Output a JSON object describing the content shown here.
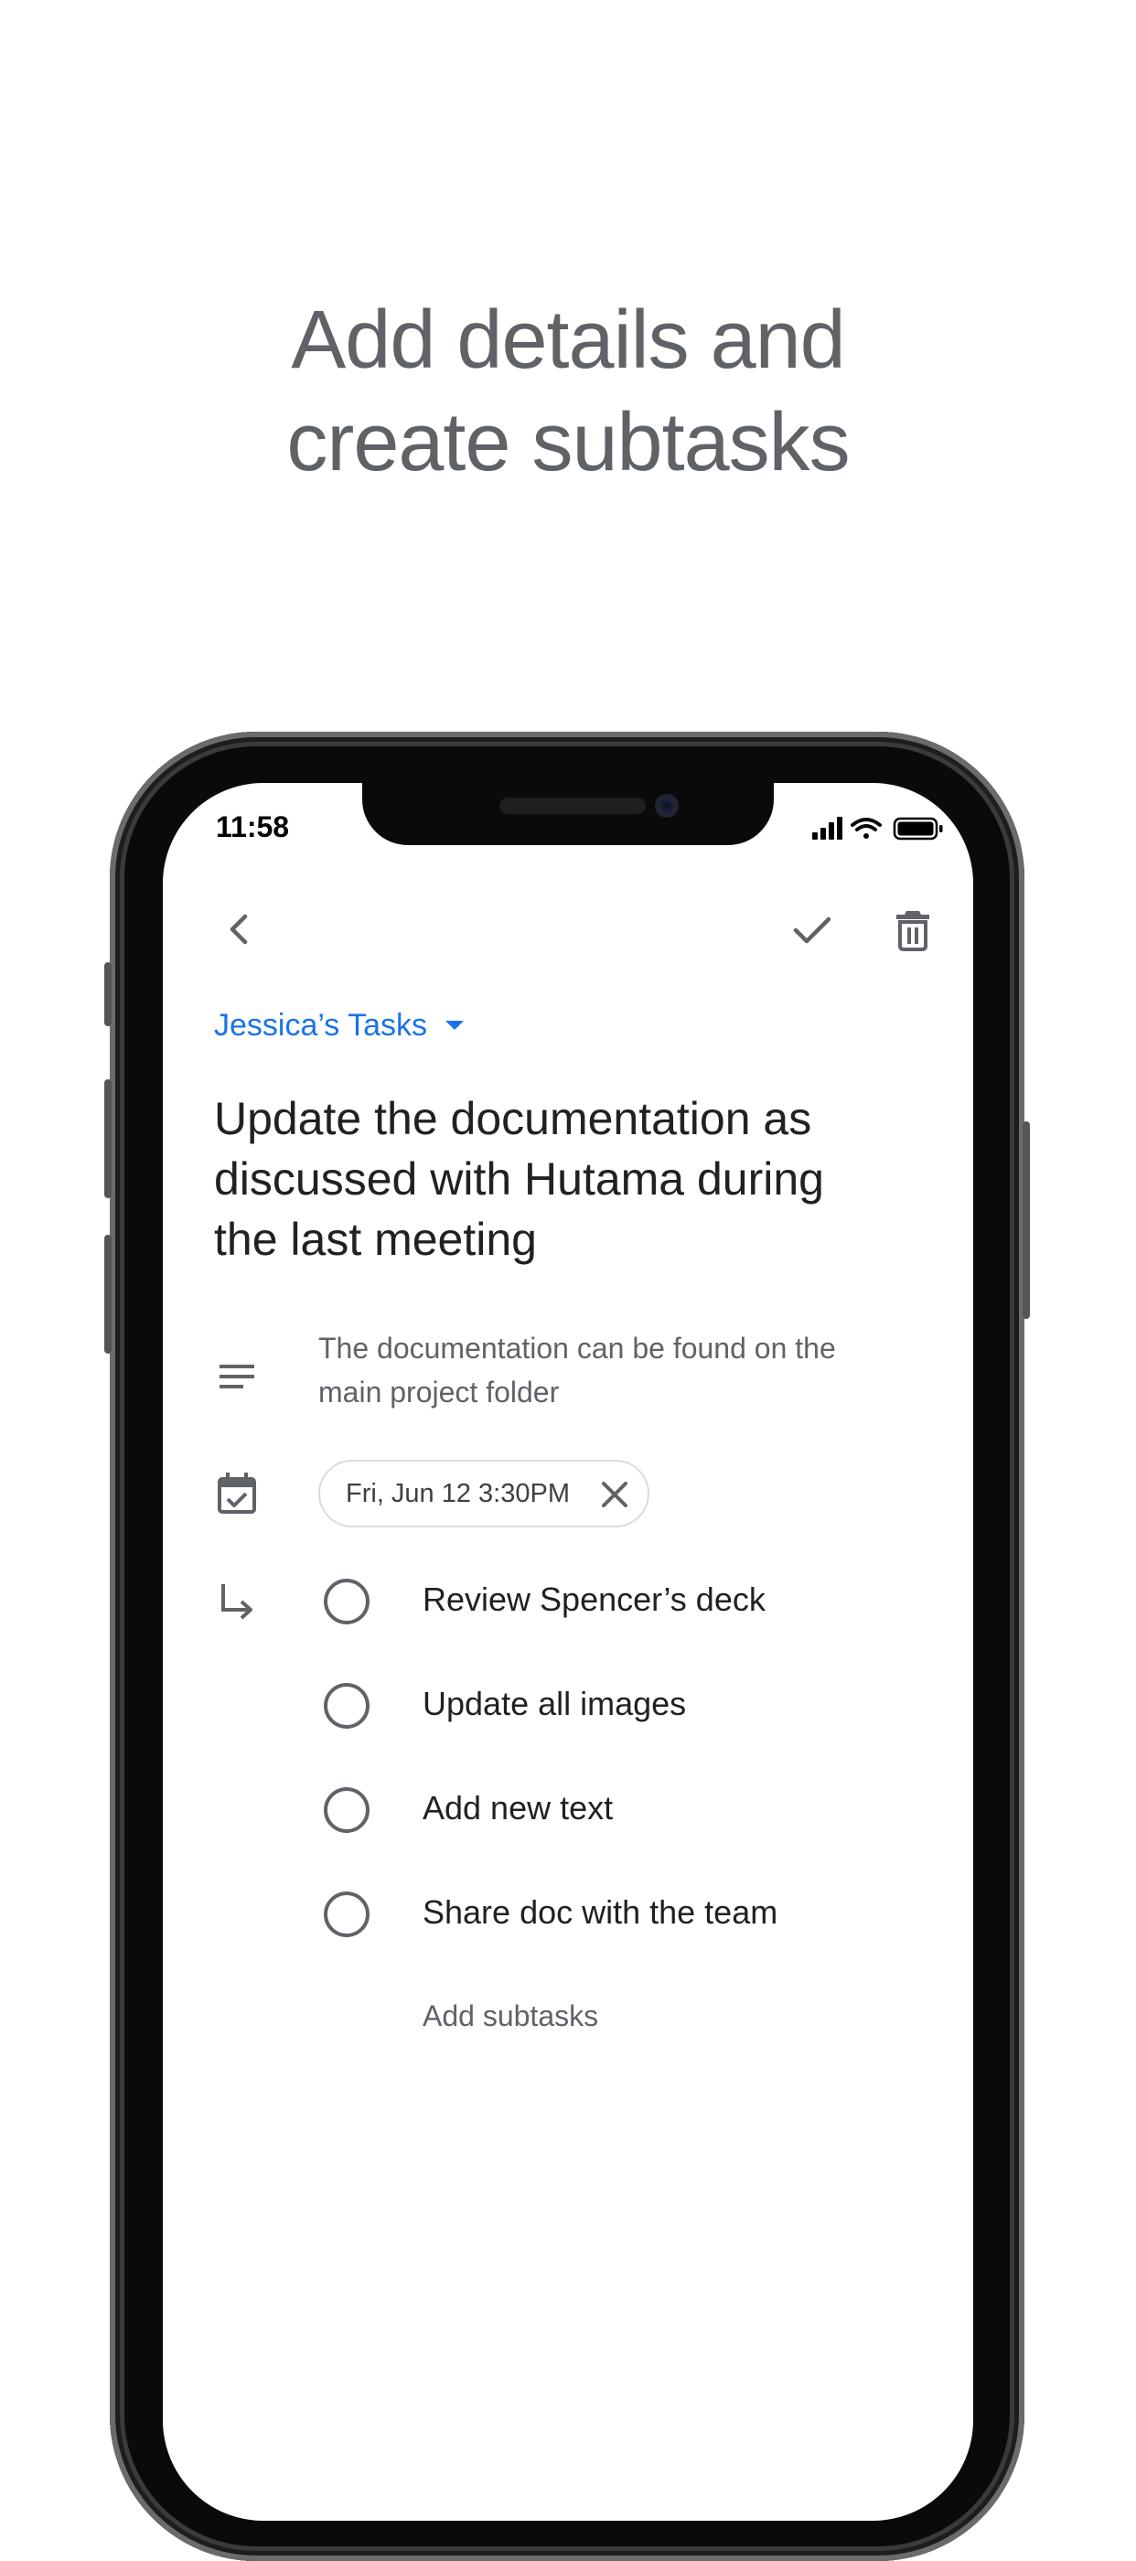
{
  "promo": {
    "headline_line1": "Add details and",
    "headline_line2": "create subtasks"
  },
  "status_bar": {
    "time": "11:58",
    "icons": [
      "cellular-signal-icon",
      "wifi-icon",
      "battery-icon"
    ]
  },
  "toolbar": {
    "back_icon": "chevron-left-icon",
    "complete_icon": "checkmark-icon",
    "delete_icon": "trash-icon"
  },
  "task": {
    "list_name": "Jessica’s Tasks",
    "title_lines": [
      "Update the documentation as",
      "discussed with Hutama during",
      "the last meeting"
    ],
    "details_lines": [
      "The documentation can be found on the",
      "main project folder"
    ],
    "due_chip": "Fri, Jun 12  3:30PM",
    "subtasks": [
      {
        "label": "Review Spencer’s deck",
        "done": false
      },
      {
        "label": "Update all images",
        "done": false
      },
      {
        "label": "Add new text",
        "done": false
      },
      {
        "label": "Share doc with the team",
        "done": false
      }
    ],
    "add_subtasks_label": "Add subtasks"
  },
  "colors": {
    "accent": "#1a73e8",
    "headline": "#5f6368",
    "text_primary": "#202124",
    "text_secondary": "#5f6368",
    "icon": "#5f6368"
  }
}
